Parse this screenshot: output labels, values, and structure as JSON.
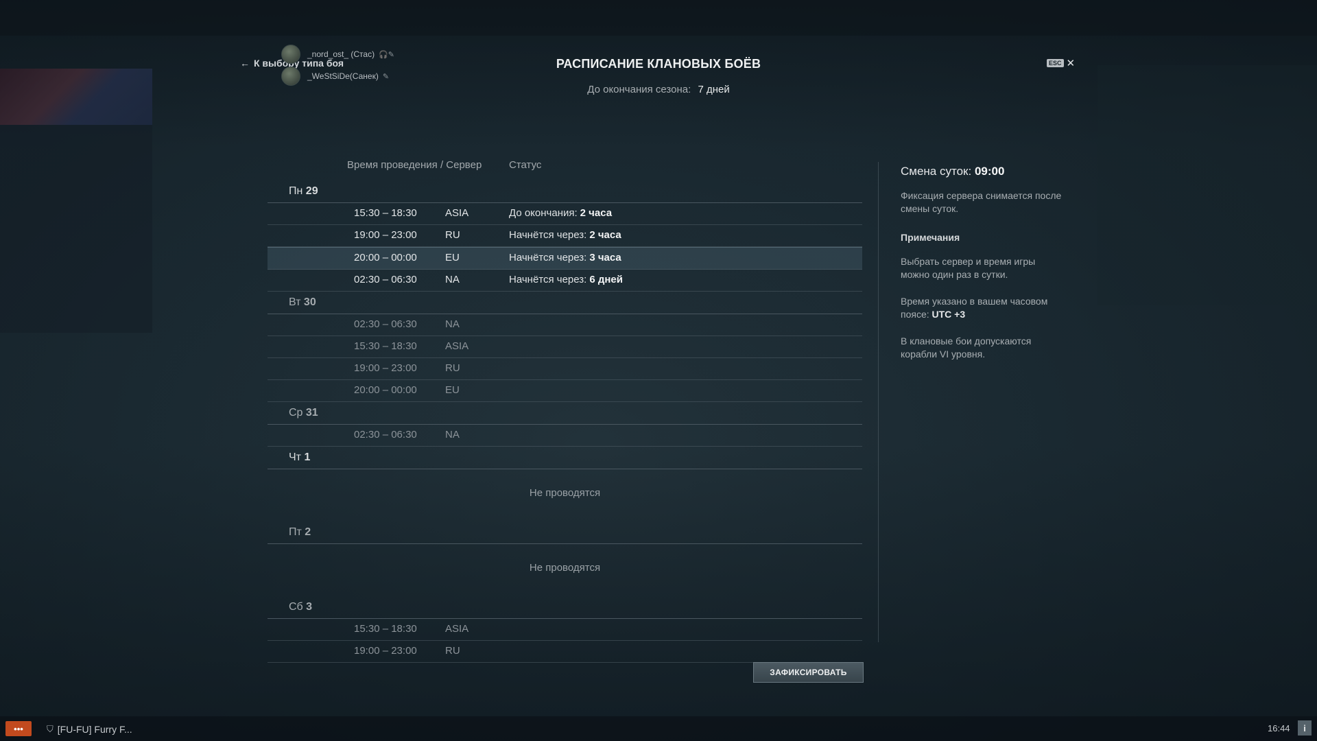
{
  "header": {
    "back_label": "К выбору типа боя",
    "title": "РАСПИСАНИЕ КЛАНОВЫХ БОЁВ",
    "season_label": "До окончания сезона:",
    "season_value": "7 дней",
    "esc_key": "ESC",
    "close_glyph": "✕"
  },
  "players": [
    {
      "name": "_nord_ost_ (Стас)"
    },
    {
      "name": "_WeStSiDe(Санек)"
    }
  ],
  "columns": {
    "time_server": "Время проведения / Сервер",
    "status": "Статус"
  },
  "days": {
    "mon": {
      "name": "Пн",
      "num": "29"
    },
    "tue": {
      "name": "Вт",
      "num": "30"
    },
    "wed": {
      "name": "Ср",
      "num": "31"
    },
    "thu": {
      "name": "Чт",
      "num": "1"
    },
    "fri": {
      "name": "Пт",
      "num": "2"
    },
    "sat": {
      "name": "Сб",
      "num": "3"
    }
  },
  "slots": {
    "mon": [
      {
        "time": "15:30 – 18:30",
        "server": "ASIA",
        "status_label": "До окончания:",
        "status_value": "2 часа"
      },
      {
        "time": "19:00 – 23:00",
        "server": "RU",
        "status_label": "Начнётся через:",
        "status_value": "2 часа"
      },
      {
        "time": "20:00 – 00:00",
        "server": "EU",
        "status_label": "Начнётся через:",
        "status_value": "3 часа"
      },
      {
        "time": "02:30 – 06:30",
        "server": "NA",
        "status_label": "Начнётся через:",
        "status_value": "6 дней"
      }
    ],
    "tue": [
      {
        "time": "02:30 – 06:30",
        "server": "NA"
      },
      {
        "time": "15:30 – 18:30",
        "server": "ASIA"
      },
      {
        "time": "19:00 – 23:00",
        "server": "RU"
      },
      {
        "time": "20:00 – 00:00",
        "server": "EU"
      }
    ],
    "wed": [
      {
        "time": "02:30 – 06:30",
        "server": "NA"
      }
    ],
    "sat": [
      {
        "time": "15:30 – 18:30",
        "server": "ASIA"
      },
      {
        "time": "19:00 – 23:00",
        "server": "RU"
      }
    ]
  },
  "no_battles": "Не проводятся",
  "notes": {
    "day_change_label": "Смена суток:",
    "day_change_value": "09:00",
    "fix_note": "Фиксация сервера снимается после смены суток.",
    "title": "Примечания",
    "note1": "Выбрать сервер и время игры можно один раз в сутки.",
    "note2_text": "Время указано в вашем часовом поясе:",
    "note2_value": "UTC +3",
    "note3": "В клановые бои допускаются корабли VI уровня."
  },
  "fix_button": "ЗАФИКСИРОВАТЬ",
  "bottom": {
    "chat_glyph": "•••",
    "clan_name": "[FU-FU] Furry F...",
    "time": "16:44",
    "info_glyph": "i"
  },
  "icons": {
    "back": "arrow-left-icon",
    "close": "close-icon",
    "mic": "mic-muted-icon",
    "shield": "clan-shield-icon",
    "chat": "chat-icon",
    "info": "info-icon"
  },
  "colors": {
    "chat_button": "#c24a1e",
    "active_row": "#3a4f5d"
  }
}
